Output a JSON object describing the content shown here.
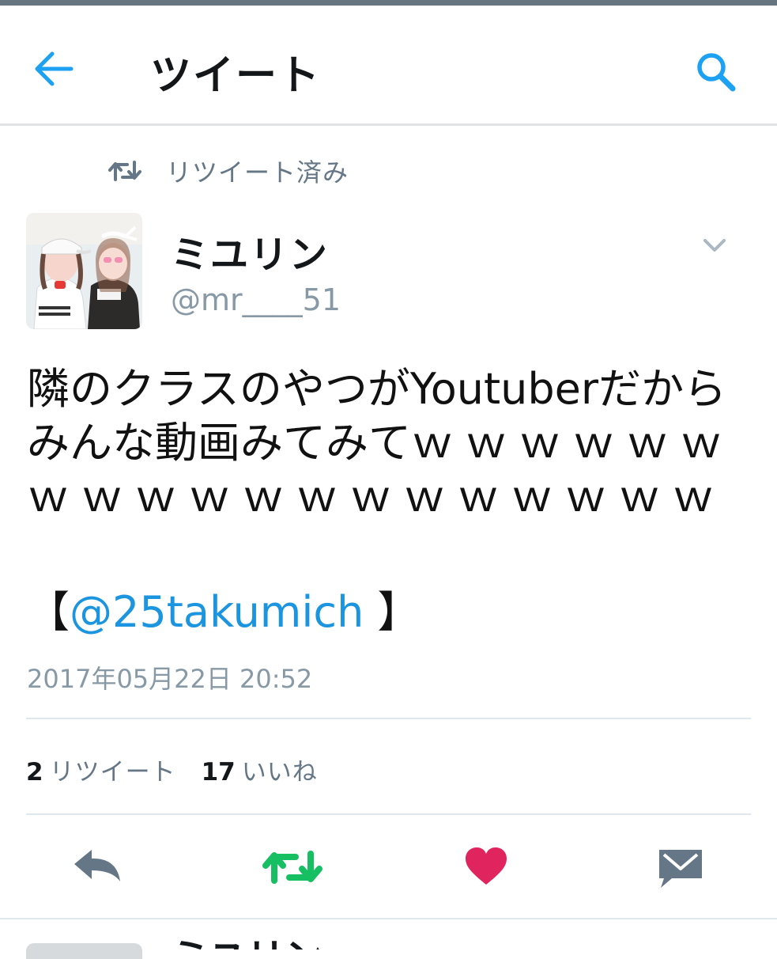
{
  "header": {
    "title": "ツイート",
    "back_icon": "back-arrow-icon",
    "search_icon": "search-icon",
    "accent": "#1da1f2"
  },
  "retweet_context": {
    "label": "リツイート済み",
    "icon": "retweet-icon"
  },
  "tweet": {
    "author": {
      "name": "ミユリン",
      "handle": "@mr____51"
    },
    "text_main": "隣のクラスのやつがYoutuberだからみんな動画みてみて",
    "text_ws_1": "ｗｗｗｗｗ",
    "text_ws_2": "ｗｗｗｗｗｗｗｗｗｗｗｗｗｗ",
    "bracket_open": "【",
    "mention": "@25takumich",
    "bracket_close": "】",
    "timestamp": "2017年05月22日 20:52",
    "stats": {
      "retweets": "2",
      "retweets_label": "リツイート",
      "likes": "17",
      "likes_label": "いいね"
    }
  },
  "actions": {
    "reply_icon": "reply-icon",
    "retweet_icon": "retweet-icon",
    "like_icon": "heart-icon",
    "dm_icon": "direct-message-icon",
    "retweet_active_color": "#17bf63",
    "like_active_color": "#e0245e"
  },
  "next_tweet": {
    "name_partial": "ミユリン"
  }
}
